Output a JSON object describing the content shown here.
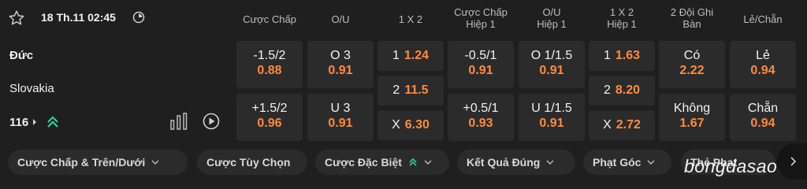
{
  "match": {
    "datetime": "18 Th.11 02:45",
    "home": "Đức",
    "away": "Slovakia",
    "more_markets": "116"
  },
  "headers": {
    "handicap": "Cược Chấp",
    "ou": "O/U",
    "x12": "1 X 2",
    "handicap_h1_a": "Cược Chấp",
    "handicap_h1_b": "Hiệp 1",
    "ou_h1_a": "O/U",
    "ou_h1_b": "Hiệp 1",
    "x12_h1_a": "1 X 2",
    "x12_h1_b": "Hiệp 1",
    "btts_a": "2 Đội Ghi",
    "btts_b": "Bàn",
    "oddeven": "Lẻ/Chẵn"
  },
  "odds": {
    "handicap_home": {
      "label": "-1.5/2",
      "odd": "0.88"
    },
    "handicap_away": {
      "label": "+1.5/2",
      "odd": "0.96"
    },
    "ou_over": {
      "label": "O 3",
      "odd": "0.91"
    },
    "ou_under": {
      "label": "U 3",
      "odd": "0.91"
    },
    "x12_home": {
      "label": "1",
      "odd": "1.24"
    },
    "x12_away": {
      "label": "2",
      "odd": "11.5"
    },
    "x12_draw": {
      "label": "X",
      "odd": "6.30"
    },
    "handicap_h1_home": {
      "label": "-0.5/1",
      "odd": "0.91"
    },
    "handicap_h1_away": {
      "label": "+0.5/1",
      "odd": "0.93"
    },
    "ou_h1_over": {
      "label": "O 1/1.5",
      "odd": "0.91"
    },
    "ou_h1_under": {
      "label": "U 1/1.5",
      "odd": "0.91"
    },
    "x12_h1_home": {
      "label": "1",
      "odd": "1.63"
    },
    "x12_h1_away": {
      "label": "2",
      "odd": "8.20"
    },
    "x12_h1_draw": {
      "label": "X",
      "odd": "2.72"
    },
    "btts_yes": {
      "label": "Có",
      "odd": "2.22"
    },
    "btts_no": {
      "label": "Không",
      "odd": "1.67"
    },
    "odd": {
      "label": "Lẻ",
      "odd": "0.94"
    },
    "even": {
      "label": "Chẵn",
      "odd": "0.94"
    }
  },
  "tabs": [
    "Cược Chấp & Trên/Dưới",
    "Cược Tùy Chọn",
    "Cược Đặc Biệt",
    "Kết Quả Đúng",
    "Phạt Góc",
    "Thẻ Phạt"
  ],
  "watermark": "bongdasao",
  "colors": {
    "background": "#1f1f1f",
    "cell": "#2b2b2b",
    "odd_value": "#ff8a3d",
    "accent_green": "#2ecc9a"
  },
  "icons": [
    "star-icon",
    "clock-icon",
    "chevron-right-icon",
    "double-chevron-up-icon",
    "stats-bars-icon",
    "play-icon",
    "chevron-down-icon"
  ]
}
